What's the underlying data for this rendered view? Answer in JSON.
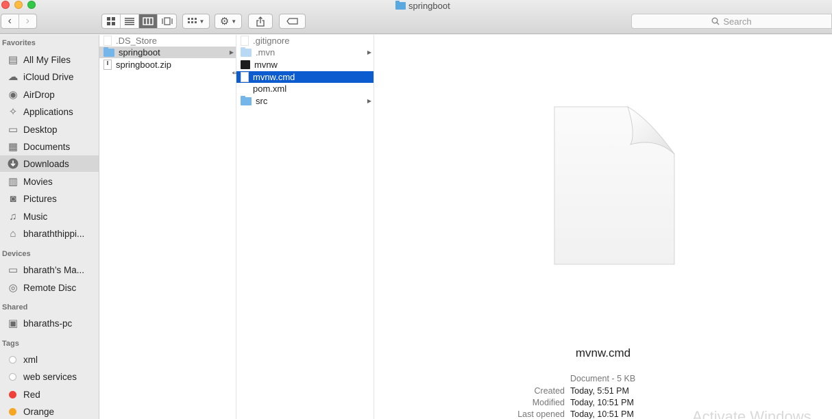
{
  "window": {
    "title": "springboot"
  },
  "toolbar": {
    "back_glyph": "‹",
    "forward_glyph": "›",
    "view_modes": [
      "icon-view",
      "list-view",
      "column-view",
      "cover-flow-view"
    ],
    "active_view": "column-view",
    "search_placeholder": "Search"
  },
  "sidebar": {
    "favorites_header": "Favorites",
    "favorites": [
      {
        "label": "All My Files",
        "icon": "all-files-icon"
      },
      {
        "label": "iCloud Drive",
        "icon": "cloud-icon"
      },
      {
        "label": "AirDrop",
        "icon": "airdrop-icon"
      },
      {
        "label": "Applications",
        "icon": "applications-icon"
      },
      {
        "label": "Desktop",
        "icon": "desktop-icon"
      },
      {
        "label": "Documents",
        "icon": "documents-icon"
      },
      {
        "label": "Downloads",
        "icon": "downloads-icon",
        "selected": true
      },
      {
        "label": "Movies",
        "icon": "movies-icon"
      },
      {
        "label": "Pictures",
        "icon": "pictures-icon"
      },
      {
        "label": "Music",
        "icon": "music-icon"
      },
      {
        "label": "bharaththippi...",
        "icon": "home-icon"
      }
    ],
    "devices_header": "Devices",
    "devices": [
      {
        "label": "bharath’s Ma...",
        "icon": "laptop-icon"
      },
      {
        "label": "Remote Disc",
        "icon": "disc-icon"
      }
    ],
    "shared_header": "Shared",
    "shared": [
      {
        "label": "bharaths-pc",
        "icon": "monitor-icon"
      }
    ],
    "tags_header": "Tags",
    "tags": [
      {
        "label": "xml",
        "color": "#ffffff"
      },
      {
        "label": "web services",
        "color": "#ffffff"
      },
      {
        "label": "Red",
        "color": "#f0403a"
      },
      {
        "label": "Orange",
        "color": "#f5a623"
      }
    ]
  },
  "column1": {
    "items": [
      {
        "name": ".DS_Store",
        "kind": "doc",
        "dim": true
      },
      {
        "name": "springboot",
        "kind": "folder",
        "selected": true,
        "has_children": true
      },
      {
        "name": "springboot.zip",
        "kind": "zip"
      }
    ]
  },
  "column2": {
    "items": [
      {
        "name": ".gitignore",
        "kind": "doc",
        "dim": true
      },
      {
        "name": ".mvn",
        "kind": "folder",
        "dim": true,
        "has_children": true
      },
      {
        "name": "mvnw",
        "kind": "exec"
      },
      {
        "name": "mvnw.cmd",
        "kind": "doc",
        "selected": true
      },
      {
        "name": "pom.xml",
        "kind": "doc"
      },
      {
        "name": "src",
        "kind": "folder",
        "has_children": true
      }
    ]
  },
  "preview": {
    "file_name": "mvnw.cmd",
    "kind_size": "Document - 5 KB",
    "created_label": "Created",
    "created_value": "Today, 5:51 PM",
    "modified_label": "Modified",
    "modified_value": "Today, 10:51 PM",
    "last_opened_label": "Last opened",
    "last_opened_value": "Today, 10:51 PM"
  },
  "watermark": "Activate Windows",
  "colors": {
    "selection_blue": "#0d5ccf",
    "folder_blue": "#74b6ea"
  }
}
